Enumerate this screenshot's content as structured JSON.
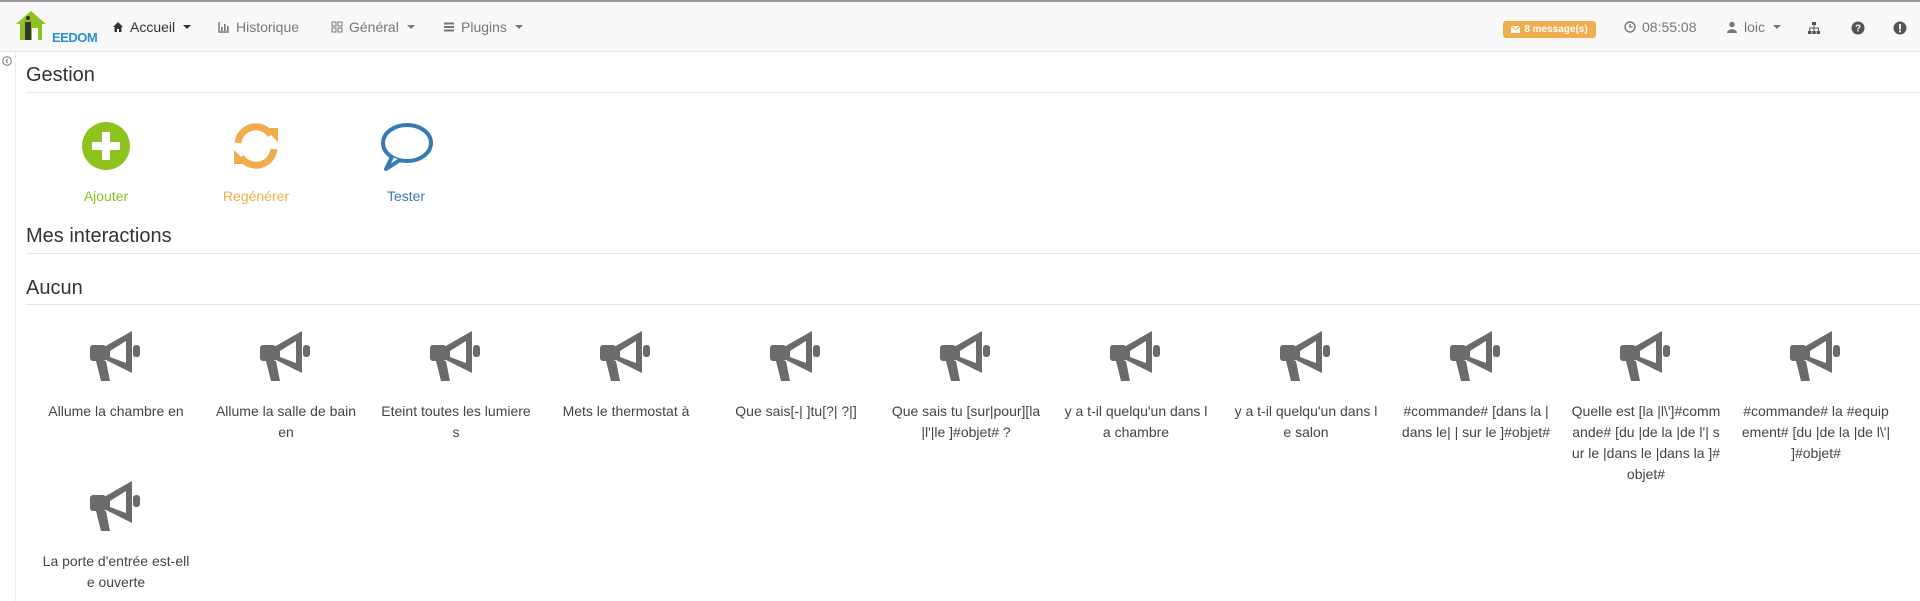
{
  "app": {
    "logo_text": "EEDOM",
    "nav": [
      {
        "label": "Accueil",
        "icon": "home-icon",
        "dropdown": true,
        "active": true
      },
      {
        "label": "Historique",
        "icon": "bar-chart-icon",
        "dropdown": false
      },
      {
        "label": "Général",
        "icon": "grid-icon",
        "dropdown": true
      },
      {
        "label": "Plugins",
        "icon": "list-icon",
        "dropdown": true
      }
    ],
    "messages_badge": "8 message(s)",
    "clock": "08:55:08",
    "user": "loic"
  },
  "gestion": {
    "title": "Gestion",
    "actions": [
      {
        "label": "Ajouter",
        "icon": "plus-circle-icon",
        "color": "#8dc21f"
      },
      {
        "label": "Regénérer",
        "icon": "refresh-icon",
        "color": "#f0ad4e"
      },
      {
        "label": "Tester",
        "icon": "comment-icon",
        "color": "#337ab7"
      }
    ]
  },
  "interactions": {
    "title": "Mes interactions",
    "group_title": "Aucun",
    "items": [
      "Allume la chambre en",
      "Allume la salle de bain en",
      "Eteint toutes les lumieres",
      "Mets le thermostat à",
      "Que sais[-| ]tu[?| ?|]",
      "Que sais tu [sur|pour][la |l'|le ]#objet# ?",
      "y a t-il quelqu'un dans la chambre",
      "y a t-il quelqu'un dans le salon",
      "#commande# [dans la |dans le| | sur le ]#objet#",
      "Quelle est [la |l\\']#commande# [du |de la |de l'| sur le |dans le |dans la ]#objet#",
      "#commande# la #equipement# [du |de la |de l\\'| ]#objet#",
      "La porte d'entrée est-elle ouverte"
    ]
  }
}
